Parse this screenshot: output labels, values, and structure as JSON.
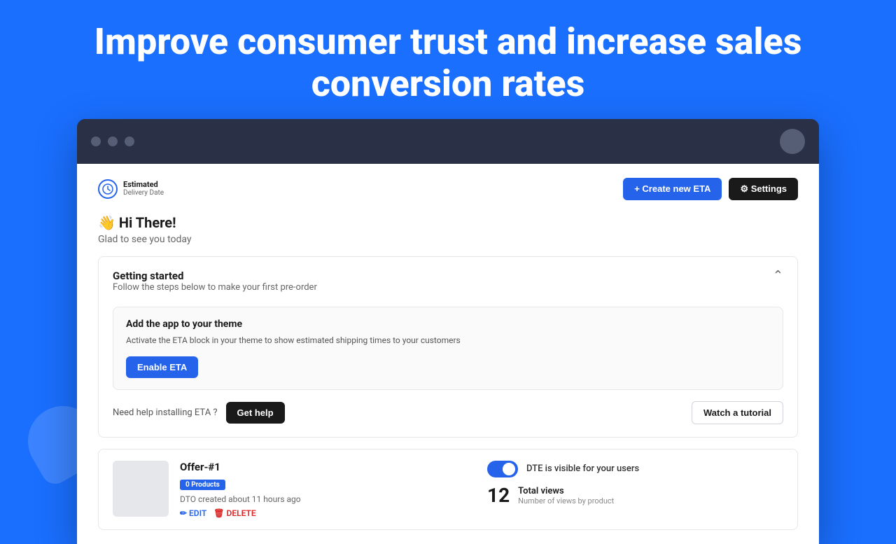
{
  "hero": {
    "title": "Improve consumer trust and increase sales conversion rates"
  },
  "browser": {
    "dots": [
      "dot1",
      "dot2",
      "dot3"
    ]
  },
  "logo": {
    "icon": "🕐",
    "line1": "Estimated",
    "line2": "Delivery Date"
  },
  "toolbar": {
    "create_label": "+ Create new ETA",
    "settings_label": "⚙ Settings"
  },
  "greeting": {
    "emoji": "👋",
    "title": "Hi There!",
    "subtitle": "Glad to see you today"
  },
  "getting_started": {
    "title": "Getting started",
    "description": "Follow the steps below to make your first pre-order",
    "inner_card": {
      "title": "Add the app to your theme",
      "description": "Activate the ETA block in your theme to show estimated shipping times to your customers",
      "button_label": "Enable ETA"
    },
    "help_text": "Need help installing ETA ?",
    "get_help_label": "Get help",
    "watch_label": "Watch a tutorial"
  },
  "offer": {
    "name": "Offer-#1",
    "badge": "0 Products",
    "created": "DTO created about 11 hours ago",
    "edit_label": "✏ EDIT",
    "delete_label": "🗑 DELETE",
    "dte_label": "DTE is visible for your users",
    "views_count": "12",
    "views_title": "Total views",
    "views_desc": "Number of views by product"
  }
}
